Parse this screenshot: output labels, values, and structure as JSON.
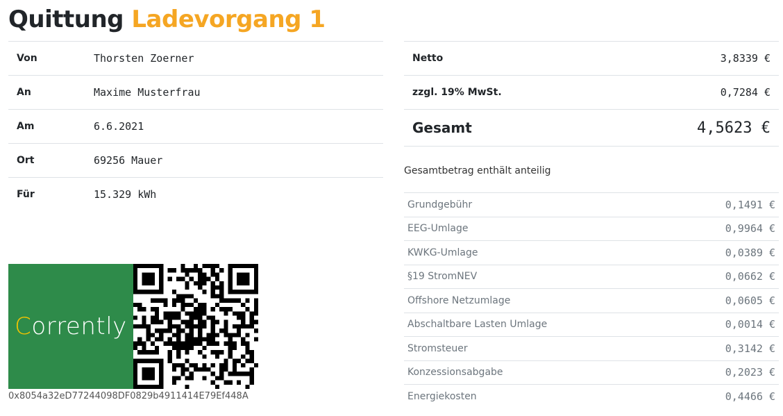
{
  "title": {
    "part1": "Quittung",
    "part2": "Ladevorgang 1"
  },
  "details": [
    {
      "label": "Von",
      "value": "Thorsten Zoerner"
    },
    {
      "label": "An",
      "value": "Maxime Musterfrau"
    },
    {
      "label": "Am",
      "value": "6.6.2021"
    },
    {
      "label": "Ort",
      "value": "69256 Mauer"
    },
    {
      "label": "Für",
      "value": "15.329 kWh"
    }
  ],
  "summary": {
    "netto_label": "Netto",
    "netto_value": "3,8339 €",
    "mwst_label": "zzgl. 19% MwSt.",
    "mwst_value": "0,7284 €",
    "gesamt_label": "Gesamt",
    "gesamt_value": "4,5623 €"
  },
  "breakdown_note": "Gesamtbetrag enthält anteilig",
  "breakdown": [
    {
      "label": "Grundgebühr",
      "value": "0,1491 €"
    },
    {
      "label": "EEG-Umlage",
      "value": "0,9964 €"
    },
    {
      "label": "KWKG-Umlage",
      "value": "0,0389 €"
    },
    {
      "label": "§19 StromNEV",
      "value": "0,0662 €"
    },
    {
      "label": "Offshore Netzumlage",
      "value": "0,0605 €"
    },
    {
      "label": "Abschaltbare Lasten Umlage",
      "value": "0,0014 €"
    },
    {
      "label": "Stromsteuer",
      "value": "0,3142 €"
    },
    {
      "label": "Konzessionsabgabe",
      "value": "0,2023 €"
    },
    {
      "label": "Energiekosten",
      "value": "0,4466 €"
    }
  ],
  "logo": {
    "first_letter": "C",
    "rest": "orrently"
  },
  "address": "0x8054a32eD77244098DF0829b4911414E79Ef448A",
  "colors": {
    "accent": "#f5a623",
    "logo_bg": "#2e8b4a",
    "logo_letter": "#f5c400"
  }
}
